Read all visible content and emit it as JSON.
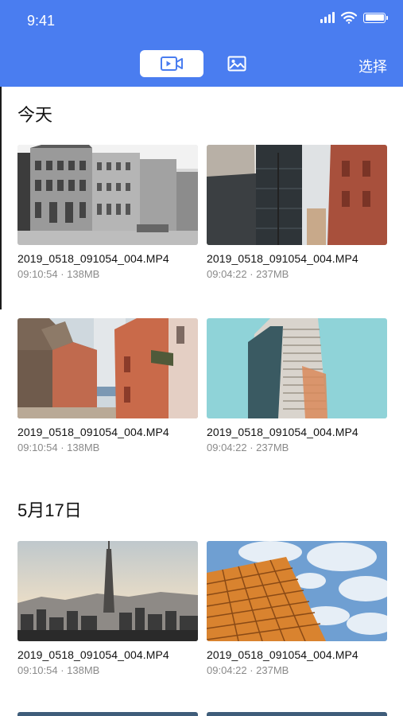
{
  "status_bar": {
    "time": "9:41",
    "icons": [
      "signal-icon",
      "wifi-icon",
      "battery-icon"
    ]
  },
  "header": {
    "tabs": [
      {
        "icon": "video-camera-icon",
        "selected": true
      },
      {
        "icon": "image-icon",
        "selected": false
      }
    ],
    "select_label": "选择"
  },
  "colors": {
    "header": "#4a7df0",
    "meta_text": "#8a8a8a"
  },
  "sections": [
    {
      "title": "今天",
      "items": [
        {
          "filename": "2019_0518_091054_004.MP4",
          "meta": "09:10:54 · 138MB",
          "thumb": "bw-street-buildings"
        },
        {
          "filename": "2019_0518_091054_004.MP4",
          "meta": "09:04:22 · 237MB",
          "thumb": "brick-alley"
        },
        {
          "filename": "2019_0518_091054_004.MP4",
          "meta": "09:10:54 · 138MB",
          "thumb": "old-town-street"
        },
        {
          "filename": "2019_0518_091054_004.MP4",
          "meta": "09:04:22 · 237MB",
          "thumb": "tower-sky"
        }
      ]
    },
    {
      "title": "5月17日",
      "items": [
        {
          "filename": "2019_0518_091054_004.MP4",
          "meta": "09:10:54 · 138MB",
          "thumb": "city-skyline"
        },
        {
          "filename": "2019_0518_091054_004.MP4",
          "meta": "09:04:22 · 237MB",
          "thumb": "building-clouds"
        }
      ]
    }
  ]
}
